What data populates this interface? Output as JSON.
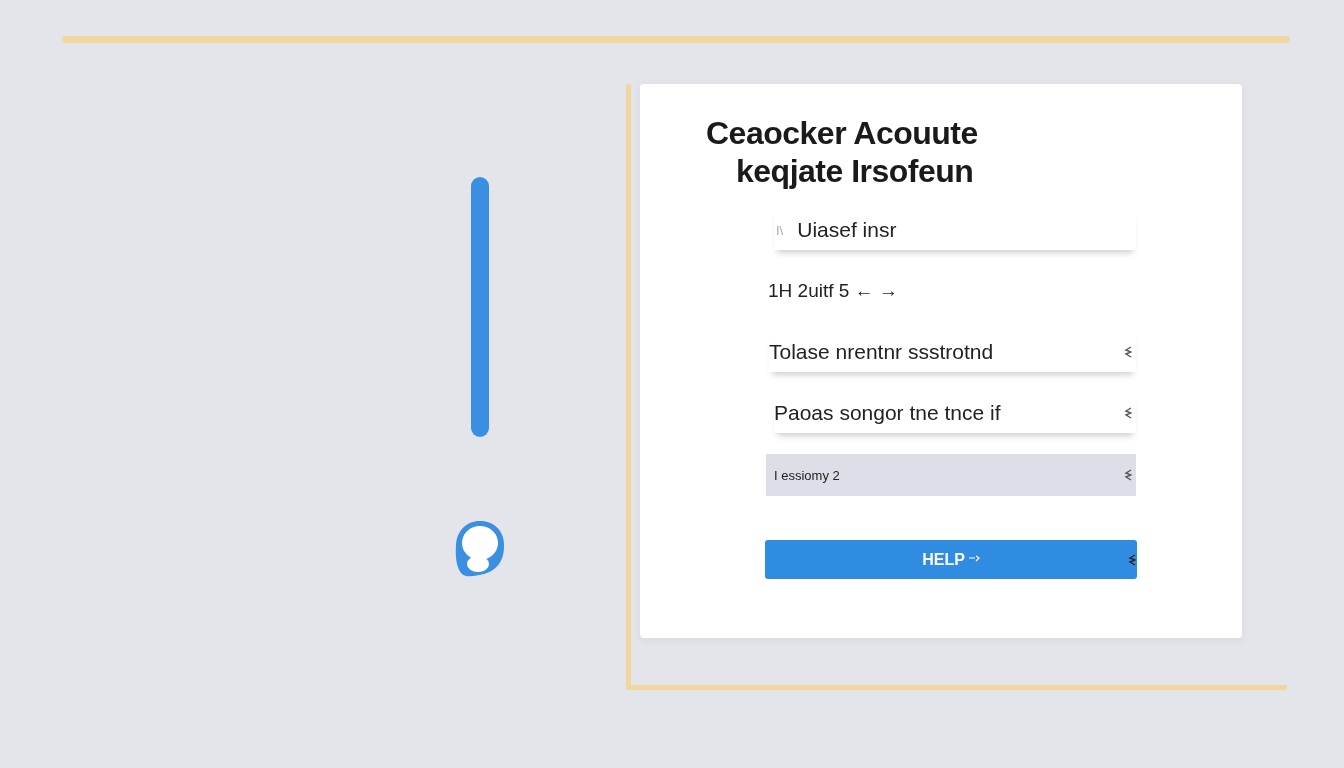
{
  "form": {
    "title_lines": [
      "Ceaocker Acouute",
      "keqjate Irsofeun"
    ],
    "rows": [
      {
        "kind": "input",
        "prefix": "I\\",
        "value": "Uiasef insr",
        "grip": false
      },
      {
        "kind": "text",
        "value": "1H 2uitf 5 ← →"
      },
      {
        "kind": "input",
        "value": "Tolase nrentnr ssstrotnd",
        "grip": true
      },
      {
        "kind": "input",
        "value": "Paoas songor tne tnce if",
        "grip": true
      },
      {
        "kind": "filled",
        "value": "I essiomy 2",
        "grip": true
      }
    ],
    "button": {
      "label": "HELP"
    }
  }
}
